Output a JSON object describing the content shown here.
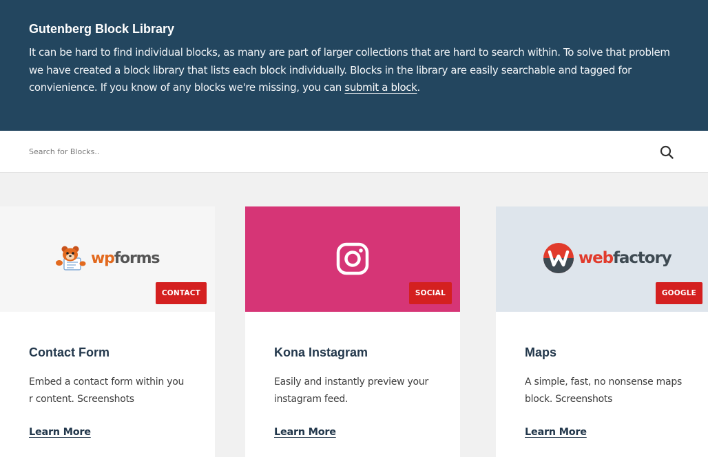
{
  "colors": {
    "hero_bg": "#23465f",
    "badge_bg": "#d42020",
    "instagram_pink": "#d63576",
    "page_bg": "#f1f1f1"
  },
  "hero": {
    "title": "Gutenberg Block Library",
    "description": "It can be hard to find individual blocks, as many are part of larger collections that are hard to search within. To solve that problem we have created a block library that lists each block individually. Blocks in the library are easily searchable and tagged for convienience. If you know of any blocks we're missing, you can ",
    "link_text": "submit a block",
    "end": "."
  },
  "search": {
    "placeholder": "Search for Blocks..",
    "icon": "search-icon"
  },
  "cards": [
    {
      "logo_part1": "wp",
      "logo_part2": "forms",
      "badge": "CONTACT",
      "title": "Contact Form",
      "description": "Embed a contact form within your content. Screenshots",
      "link": "Learn More"
    },
    {
      "logo_icon": "instagram-icon",
      "badge": "SOCIAL",
      "title": "Kona Instagram",
      "description": "Easily and instantly preview your instagram feed.",
      "link": "Learn More"
    },
    {
      "logo_part1": "web",
      "logo_part2": "factory",
      "badge": "GOOGLE",
      "title": "Maps",
      "description": "A simple, fast, no nonsense maps block. Screenshots",
      "link": "Learn More"
    }
  ]
}
